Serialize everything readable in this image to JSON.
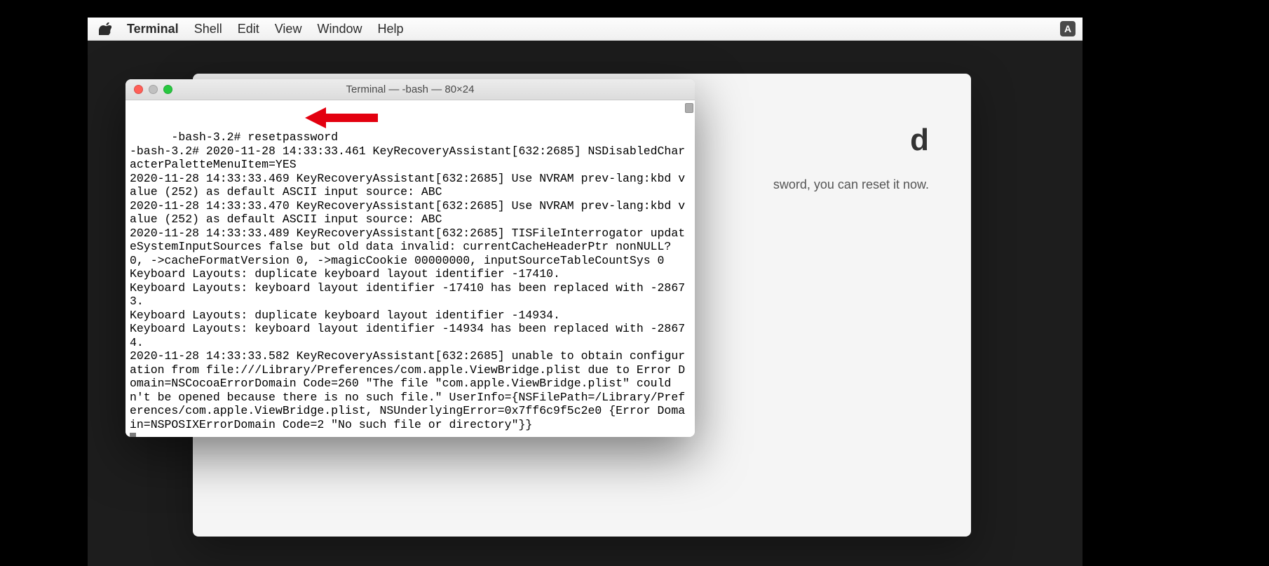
{
  "menubar": {
    "app_name": "Terminal",
    "items": [
      "Shell",
      "Edit",
      "View",
      "Window",
      "Help"
    ],
    "input_indicator": "A"
  },
  "background_window": {
    "title_suffix": "d",
    "body_suffix": "sword, you can reset it now."
  },
  "terminal": {
    "title": "Terminal — -bash — 80×24",
    "prompt1": "-bash-3.2# ",
    "command1": "resetpassword",
    "lines": [
      "-bash-3.2# 2020-11-28 14:33:33.461 KeyRecoveryAssistant[632:2685] NSDisabledCharacterPaletteMenuItem=YES",
      "2020-11-28 14:33:33.469 KeyRecoveryAssistant[632:2685] Use NVRAM prev-lang:kbd value (252) as default ASCII input source: ABC",
      "2020-11-28 14:33:33.470 KeyRecoveryAssistant[632:2685] Use NVRAM prev-lang:kbd value (252) as default ASCII input source: ABC",
      "2020-11-28 14:33:33.489 KeyRecoveryAssistant[632:2685] TISFileInterrogator updateSystemInputSources false but old data invalid: currentCacheHeaderPtr nonNULL? 0, ->cacheFormatVersion 0, ->magicCookie 00000000, inputSourceTableCountSys 0",
      "Keyboard Layouts: duplicate keyboard layout identifier -17410.",
      "Keyboard Layouts: keyboard layout identifier -17410 has been replaced with -28673.",
      "Keyboard Layouts: duplicate keyboard layout identifier -14934.",
      "Keyboard Layouts: keyboard layout identifier -14934 has been replaced with -28674.",
      "2020-11-28 14:33:33.582 KeyRecoveryAssistant[632:2685] unable to obtain configuration from file:///Library/Preferences/com.apple.ViewBridge.plist due to Error Domain=NSCocoaErrorDomain Code=260 \"The file \"com.apple.ViewBridge.plist\" couldn't be opened because there is no such file.\" UserInfo={NSFilePath=/Library/Preferences/com.apple.ViewBridge.plist, NSUnderlyingError=0x7ff6c9f5c2e0 {Error Domain=NSPOSIXErrorDomain Code=2 \"No such file or directory\"}}"
    ]
  },
  "annotation": {
    "arrow_color": "#e3000f"
  }
}
